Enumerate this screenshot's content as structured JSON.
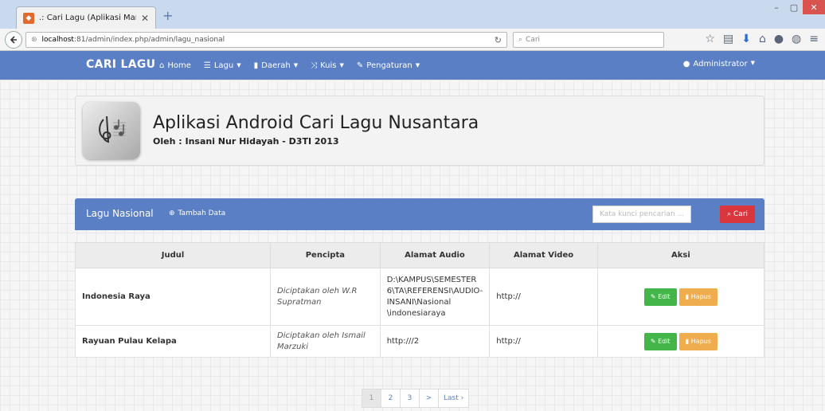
{
  "browser": {
    "tab_title": ".: Cari Lagu (Aplikasi Man...",
    "tab_close": "✕",
    "new_tab": "+",
    "url_host": "localhost",
    "url_rest": ":81/admin/index.php/admin/lagu_nasional",
    "search_placeholder": "Cari",
    "window_controls": [
      "–",
      "▢",
      "✕"
    ]
  },
  "navbar": {
    "brand": "CARI LAGU",
    "items": [
      {
        "label": "Home",
        "icon": "home-icon",
        "dropdown": false
      },
      {
        "label": "Lagu",
        "icon": "list-icon",
        "dropdown": true
      },
      {
        "label": "Daerah",
        "icon": "file-icon",
        "dropdown": true
      },
      {
        "label": "Kuis",
        "icon": "random-icon",
        "dropdown": true
      },
      {
        "label": "Pengaturan",
        "icon": "pencil-icon",
        "dropdown": true
      }
    ],
    "user": "Administrator"
  },
  "header": {
    "title": "Aplikasi Android Cari Lagu Nusantara",
    "subtitle": "Oleh : Insani Nur Hidayah - D3TI 2013"
  },
  "panel": {
    "title": "Lagu Nasional",
    "add_label": "Tambah Data",
    "search_placeholder": "Kata kunci pencarian ...",
    "search_button": "Cari"
  },
  "table": {
    "columns": [
      "Judul",
      "Pencipta",
      "Alamat Audio",
      "Alamat Video",
      "Aksi"
    ],
    "rows": [
      {
        "judul": "Indonesia Raya",
        "pencipta": "Diciptakan oleh W.R Supratman",
        "audio": "D:\\KAMPUS\\SEMESTER 6\\TA\\REFERENSI\\AUDIO-INSANI\\Nasional \\indonesiaraya",
        "video": "http://",
        "edit": "Edit",
        "hapus": "Hapus"
      },
      {
        "judul": "Rayuan Pulau Kelapa",
        "pencipta": "Diciptakan oleh Ismail Marzuki",
        "audio": "http:///2",
        "video": "http://",
        "edit": "Edit",
        "hapus": "Hapus"
      }
    ]
  },
  "pagination": [
    "1",
    "2",
    "3",
    ">",
    "Last ›"
  ],
  "colors": {
    "primary": "#5b7fc4",
    "danger": "#d9363e",
    "success": "#44b649",
    "warning": "#f0ad4e"
  }
}
